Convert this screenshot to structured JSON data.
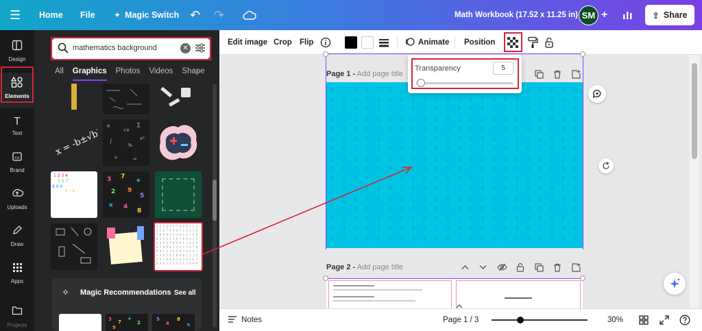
{
  "topbar": {
    "home": "Home",
    "file": "File",
    "magic_switch": "Magic Switch",
    "title": "Math Workbook (17.52 x 11.25 in)",
    "avatar_initials": "SM",
    "share": "Share"
  },
  "rail": {
    "items": [
      {
        "label": "Design",
        "icon": "design-icon"
      },
      {
        "label": "Elements",
        "icon": "elements-icon"
      },
      {
        "label": "Text",
        "icon": "text-icon"
      },
      {
        "label": "Brand",
        "icon": "brand-icon"
      },
      {
        "label": "Uploads",
        "icon": "uploads-icon"
      },
      {
        "label": "Draw",
        "icon": "draw-icon"
      },
      {
        "label": "Apps",
        "icon": "apps-icon"
      },
      {
        "label": "Projects",
        "icon": "projects-icon"
      }
    ],
    "active": "Elements"
  },
  "panel": {
    "search_value": "mathematics background",
    "tabs": [
      "All",
      "Graphics",
      "Photos",
      "Videos",
      "Shape"
    ],
    "active_tab": "Graphics",
    "magic_rec_title": "Magic Recommendations",
    "see_all": "See all"
  },
  "canvas_toolbar": {
    "edit_image": "Edit image",
    "crop": "Crop",
    "flip": "Flip",
    "animate": "Animate",
    "position": "Position"
  },
  "transparency": {
    "label": "Transparency",
    "value": "5",
    "slider_fraction": 0.05
  },
  "pages": {
    "page1_label": "Page 1 -",
    "page1_title_placeholder": "Add page title",
    "page2_label": "Page 2 -",
    "page2_title_placeholder": "Add page title"
  },
  "bottombar": {
    "notes": "Notes",
    "page_indicator": "Page 1 / 3",
    "zoom": "30%",
    "zoom_fraction": 0.3
  },
  "colors": {
    "canvas_cyan": "#00c4e3",
    "accent_purple": "#8b3dff",
    "highlight_red": "#d3263a",
    "text_color_swatch": "#000000"
  }
}
